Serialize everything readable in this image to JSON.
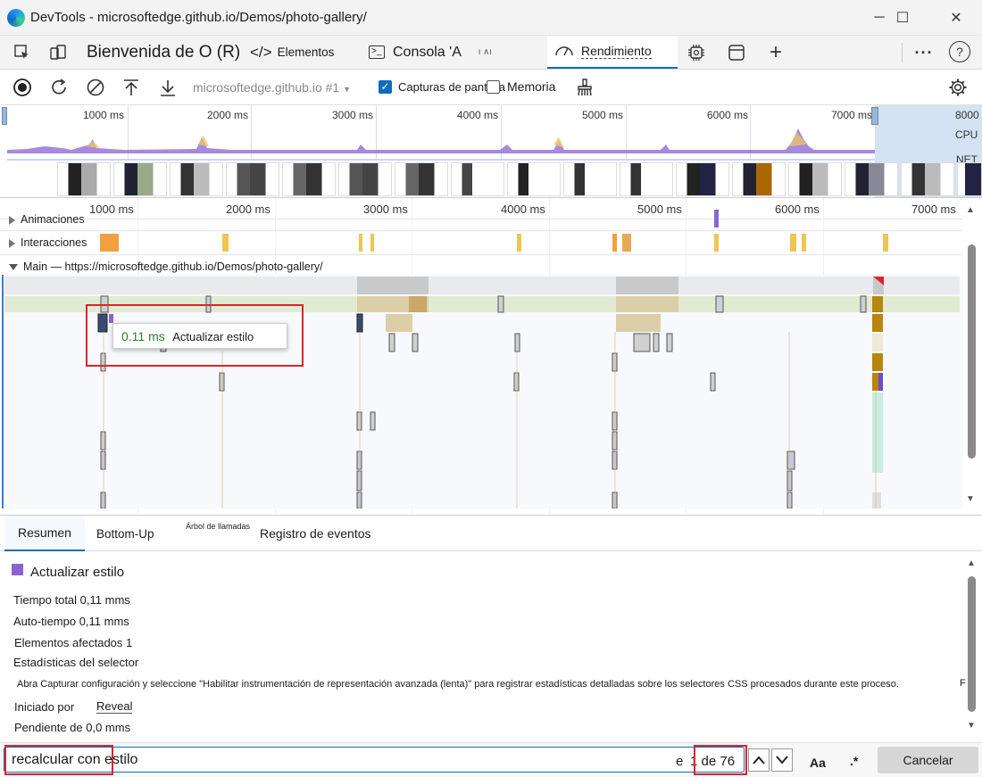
{
  "window": {
    "title": "DevTools - microsoftedge.github.io/Demos/photo-gallery/",
    "minimize": "─",
    "maximize": "☐",
    "close": "✕"
  },
  "tabs": {
    "welcome": "Bienvenida de O (R)",
    "elements": "Elementos",
    "console": "Consola 'A",
    "sources_hint": "ι ∧ι",
    "performance": "Rendimiento"
  },
  "toolbar": {
    "target": "microsoftedge.github.io #1",
    "screenshots_label": "Capturas de pantalla",
    "screenshots_checked": true,
    "memory_label": "Memoria"
  },
  "overview": {
    "ticks": [
      "1000 ms",
      "2000 ms",
      "3000 ms",
      "4000 ms",
      "5000 ms",
      "6000 ms",
      "7000 ms",
      "8000"
    ],
    "cpu_label": "CPU",
    "net_label": "NET"
  },
  "timeline": {
    "ticks": [
      "1000 ms",
      "2000 ms",
      "3000 ms",
      "4000 ms",
      "5000 ms",
      "6000 ms",
      "7000 ms"
    ],
    "tracks": {
      "animations": "Animaciones",
      "interactions": "Interacciones",
      "main": "Main — https://microsoftedge.github.io/Demos/photo-gallery/"
    },
    "tooltip": {
      "duration": "0.11 ms",
      "name": "Actualizar estilo"
    }
  },
  "bottom_tabs": [
    "Resumen",
    "Bottom-Up",
    "Árbol de llamadas",
    "Registro de eventos"
  ],
  "summary": {
    "title": "Actualizar estilo",
    "color": "#8a63d2",
    "total_time": "Tiempo total 0,11 mms",
    "self_time": "Auto-tiempo 0,11 mms",
    "elements_affected": "Elementos afectados 1",
    "selector_stats": "Estadísticas del selector",
    "selector_note": "Abra Capturar configuración y seleccione \"Habilitar instrumentación de representación avanzada (lenta)\" para registrar estadísticas detalladas sobre los selectores CSS procesados durante este proceso.",
    "initiated_by_label": "Iniciado por",
    "initiated_by_link": "Reveal",
    "pending": "Pendiente de 0,0 mms",
    "trailing": "F"
  },
  "search": {
    "query": "recalcular con estilo",
    "match_prefix": "e",
    "match_count": "1 de 76",
    "case_label": "Aa",
    "regex_label": ".*",
    "cancel_label": "Cancelar"
  },
  "colors": {
    "accent": "#0f6cbd",
    "highlight": "#d9262c",
    "rendering": "#8a63d2",
    "scripting": "#f1c453",
    "loading": "#a6c8e8"
  }
}
